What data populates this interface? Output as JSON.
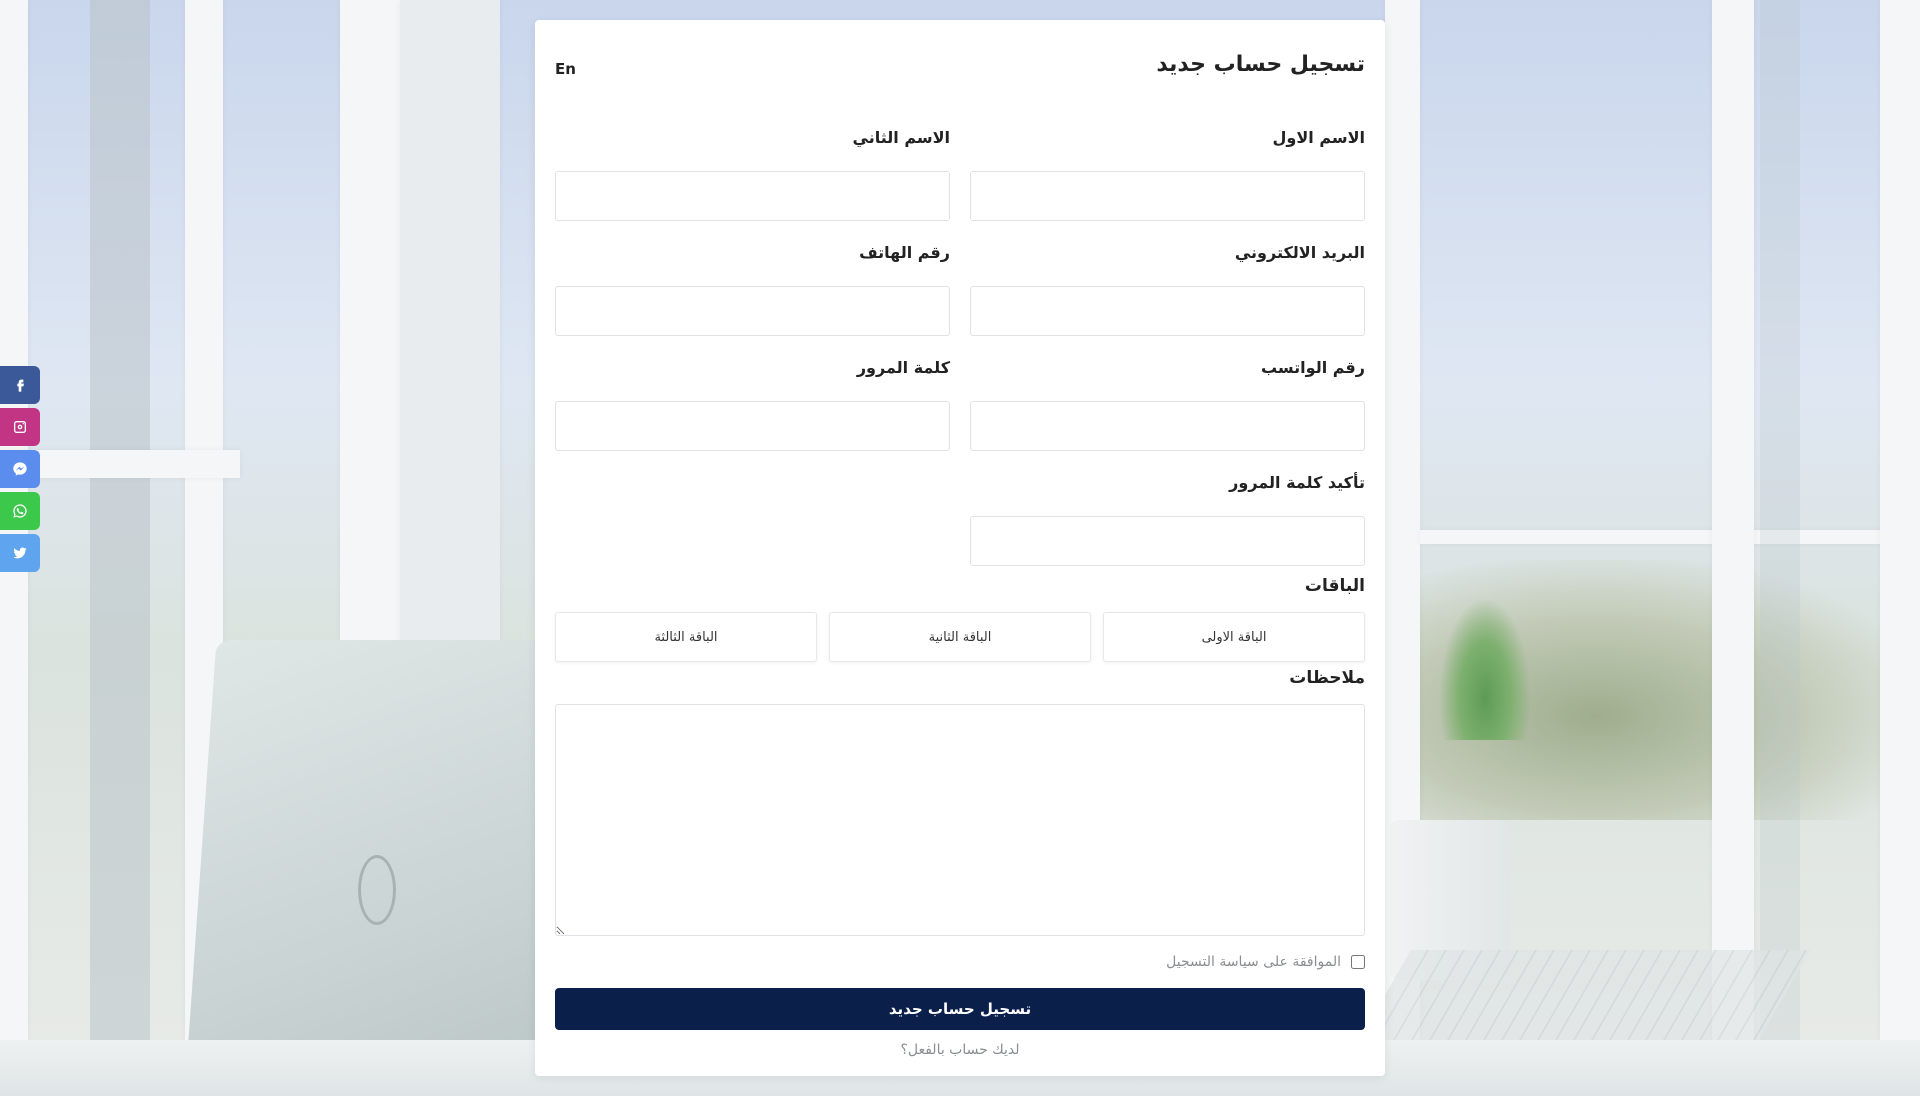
{
  "social": {
    "items": [
      {
        "icon": "facebook-icon",
        "color": "#3b5998"
      },
      {
        "icon": "instagram-icon",
        "color": "#c13584"
      },
      {
        "icon": "messenger-icon",
        "color": "#5b8def"
      },
      {
        "icon": "whatsapp-icon",
        "color": "#3cc84a"
      },
      {
        "icon": "twitter-icon",
        "color": "#5fa4ee"
      }
    ]
  },
  "form": {
    "title": "تسجيل حساب جديد",
    "language_toggle": "En",
    "fields": {
      "first_name": {
        "label": "الاسم الاول",
        "value": ""
      },
      "last_name": {
        "label": "الاسم الثاني",
        "value": ""
      },
      "email": {
        "label": "البريد الالكتروني",
        "value": ""
      },
      "phone": {
        "label": "رقم الهاتف",
        "value": ""
      },
      "whatsapp": {
        "label": "رقم الواتسب",
        "value": ""
      },
      "password": {
        "label": "كلمة المرور",
        "value": ""
      },
      "confirm_password": {
        "label": "تأكيد كلمة المرور",
        "value": ""
      }
    },
    "packages_label": "الباقات",
    "packages": [
      "الباقة الاولى",
      "الباقة الثانية",
      "الباقة الثالثة"
    ],
    "notes_label": "ملاحظات",
    "notes_value": "",
    "agree_label": "الموافقة على سياسة التسجيل",
    "agree_checked": false,
    "submit_label": "تسجيل حساب جديد",
    "login_link": "لديك حساب بالفعل؟",
    "submit_color": "#0b1f4b"
  }
}
